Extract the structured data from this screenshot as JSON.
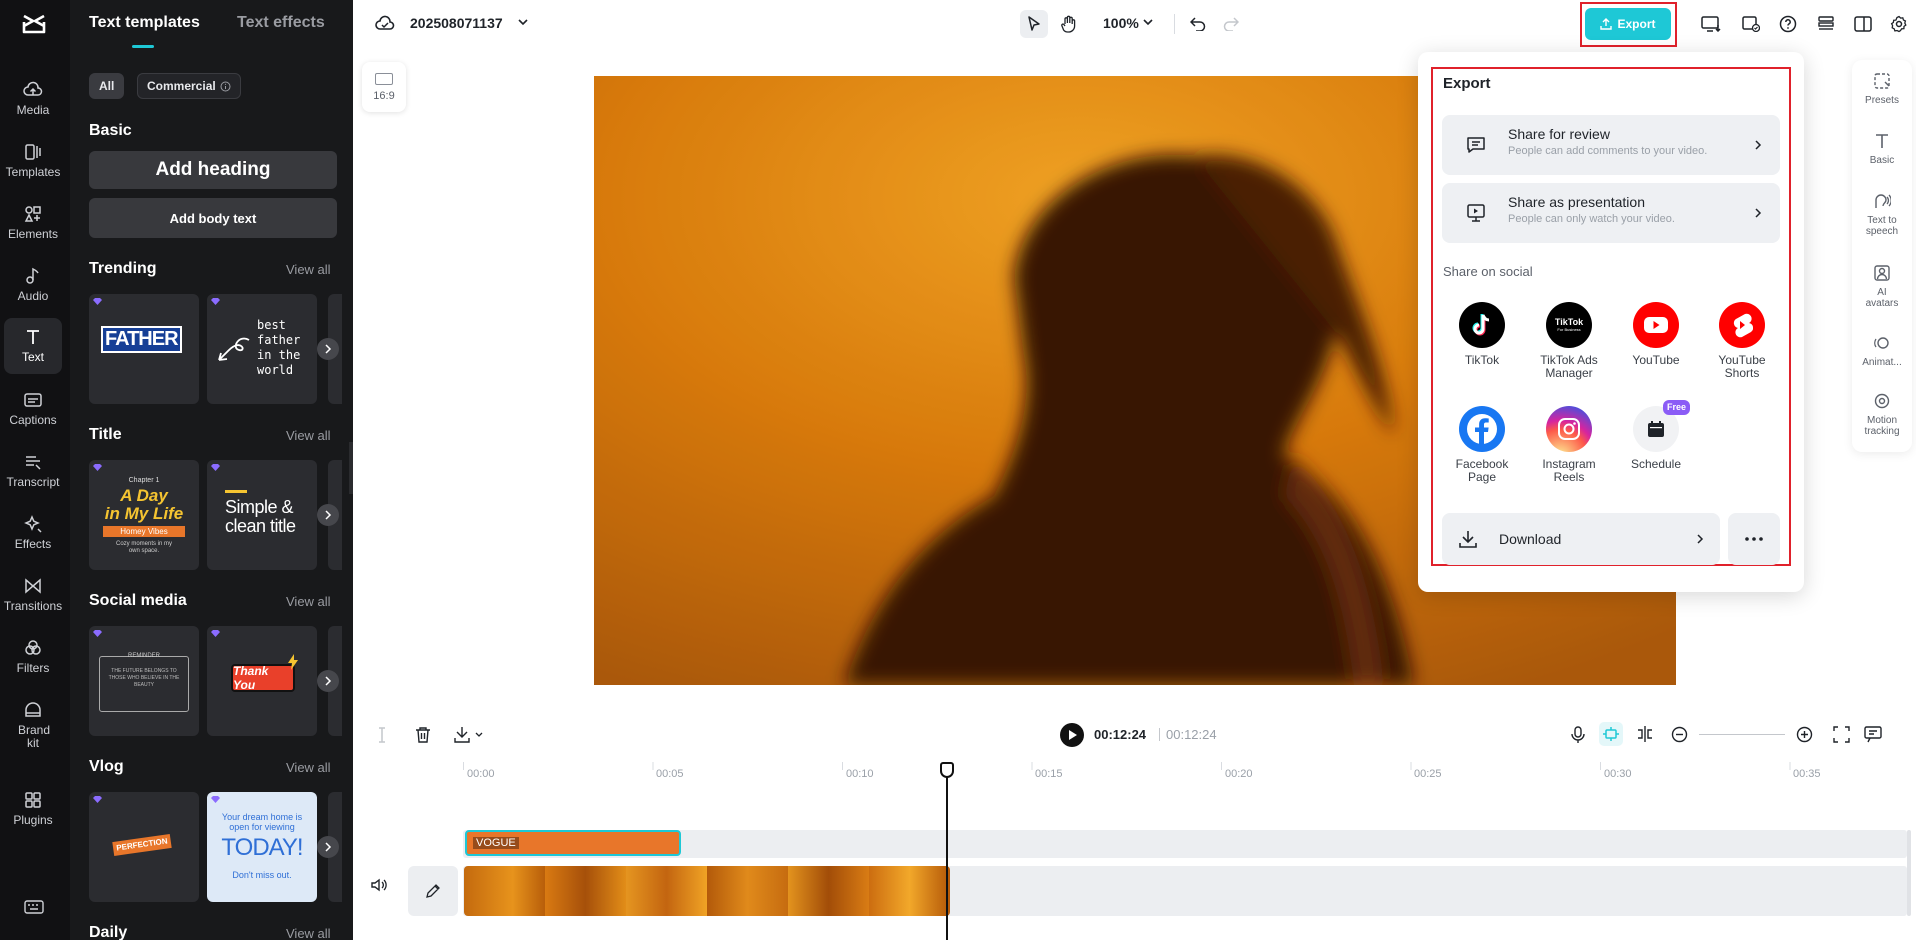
{
  "left_rail": {
    "items": [
      {
        "label": "Media",
        "icon": "cloud-upload-icon"
      },
      {
        "label": "Templates",
        "icon": "templates-icon"
      },
      {
        "label": "Elements",
        "icon": "shapes-icon"
      },
      {
        "label": "Audio",
        "icon": "music-note-icon"
      },
      {
        "label": "Text",
        "icon": "text-icon",
        "active": true
      },
      {
        "label": "Captions",
        "icon": "captions-icon"
      },
      {
        "label": "Transcript",
        "icon": "transcript-icon"
      },
      {
        "label": "Effects",
        "icon": "sparkle-icon"
      },
      {
        "label": "Transitions",
        "icon": "transitions-icon"
      },
      {
        "label": "Filters",
        "icon": "filters-icon"
      },
      {
        "label": "Brand kit",
        "icon": "brand-kit-icon"
      },
      {
        "label": "Plugins",
        "icon": "plugins-icon"
      }
    ]
  },
  "panel": {
    "tabs": [
      "Text templates",
      "Text effects"
    ],
    "filters": [
      "All",
      "Commercial"
    ],
    "basic_title": "Basic",
    "add_heading": "Add heading",
    "add_body": "Add body text",
    "view_all": "View all",
    "sections": [
      "Trending",
      "Title",
      "Social media",
      "Vlog",
      "Daily"
    ],
    "cards": {
      "father": "FATHER",
      "best_father": [
        "best",
        "father",
        "in the",
        "world"
      ],
      "chapter": "Chapter 1",
      "a_day": "A Day",
      "in_my_life": "in My Life",
      "homey": "Homey Vibes",
      "cozy": "Cozy moments in my own space.",
      "simple": "Simple &",
      "clean": "clean title",
      "reminder": "REMINDER",
      "future": "THE FUTURE BELONGS TO THOSE WHO BELIEVE IN THE BEAUTY",
      "thank_you": "Thank You",
      "perfection": "PERFECTION",
      "dream": "Your dream home is open for viewing",
      "today": "TODAY!",
      "dont_miss": "Don't miss out."
    }
  },
  "topbar": {
    "project_name": "202508071137",
    "zoom": "100%",
    "export_label": "Export",
    "aspect": "16:9"
  },
  "export_popup": {
    "title": "Export",
    "share_review": {
      "title": "Share for review",
      "sub": "People can add comments to your video."
    },
    "share_presentation": {
      "title": "Share as presentation",
      "sub": "People can only watch your video."
    },
    "share_social_label": "Share on social",
    "socials": [
      {
        "label": "TikTok",
        "icon": "tiktok-icon",
        "color": "#000000"
      },
      {
        "label": "TikTok Ads Manager",
        "icon": "tiktok-ads-icon",
        "color": "#000000"
      },
      {
        "label": "YouTube",
        "icon": "youtube-icon",
        "color": "#ff0000"
      },
      {
        "label": "YouTube Shorts",
        "icon": "youtube-shorts-icon",
        "color": "#ff0000"
      },
      {
        "label": "Facebook Page",
        "icon": "facebook-icon",
        "color": "#1877f2"
      },
      {
        "label": "Instagram Reels",
        "icon": "instagram-icon",
        "color": "#d62976"
      },
      {
        "label": "Schedule",
        "icon": "calendar-icon",
        "color": "#f1f2f4"
      }
    ],
    "free_badge": "Free",
    "tiktok_ads_text": [
      "TikTok",
      "For Business"
    ],
    "download": "Download"
  },
  "right_rail": [
    {
      "label": "Presets",
      "icon": "presets-icon"
    },
    {
      "label": "Basic",
      "icon": "text-basic-icon"
    },
    {
      "label": "Text to speech",
      "icon": "text-to-speech-icon"
    },
    {
      "label": "AI avatars",
      "icon": "ai-avatar-icon"
    },
    {
      "label": "Animat...",
      "icon": "animation-icon"
    },
    {
      "label": "Motion tracking",
      "icon": "motion-tracking-icon"
    }
  ],
  "timeline": {
    "current_time": "00:12:24",
    "total_time": "00:12:24",
    "ticks": [
      "00:00",
      "00:05",
      "00:10",
      "00:15",
      "00:20",
      "00:25",
      "00:30",
      "00:35"
    ],
    "text_clip": "VOGUE"
  },
  "colors": {
    "accent": "#1ec8d6",
    "highlight": "#e0212b",
    "panel_bg": "#18191b",
    "rail_bg": "#111113",
    "clip_orange": "#e8762a"
  }
}
